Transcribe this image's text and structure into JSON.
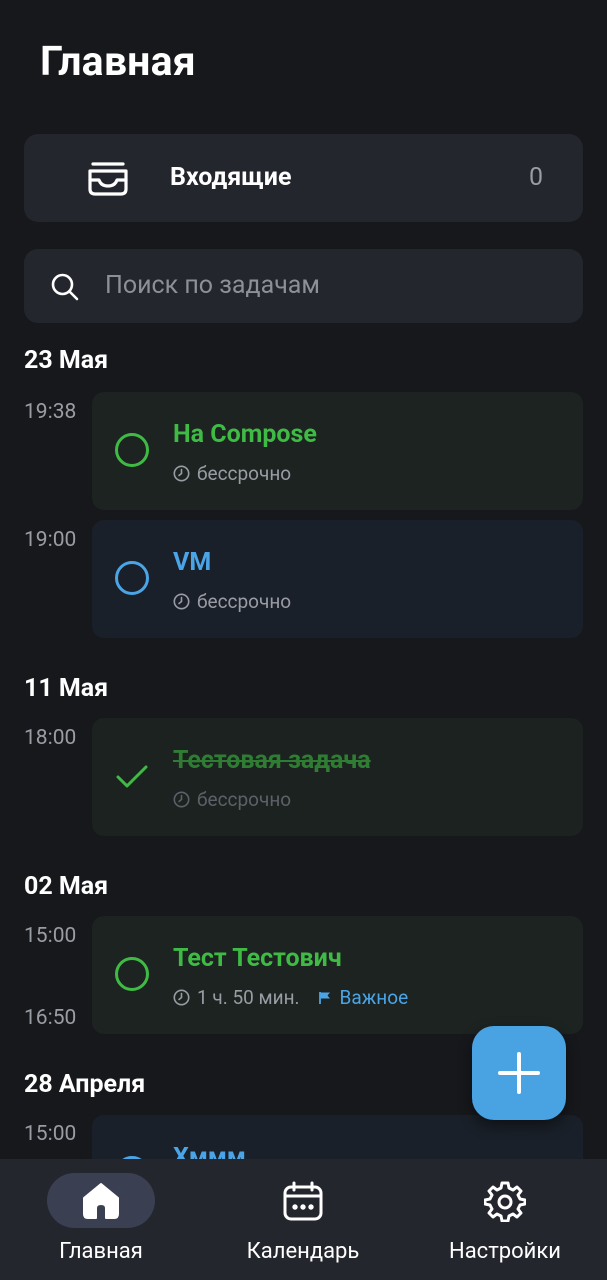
{
  "header": {
    "title": "Главная"
  },
  "inbox": {
    "label": "Входящие",
    "count": "0"
  },
  "search": {
    "placeholder": "Поиск по задачам"
  },
  "groups": [
    {
      "date": "23 Мая",
      "tasks": [
        {
          "time": "19:38",
          "title": "На Compose",
          "duration": "бессрочно",
          "color": "#3fbb45",
          "status": "open"
        },
        {
          "time": "19:00",
          "title": "VM",
          "duration": "бессрочно",
          "color": "#4aa4e6",
          "status": "open"
        }
      ]
    },
    {
      "date": "11 Мая",
      "tasks": [
        {
          "time": "18:00",
          "title": "Тестовая задача",
          "duration": "бессрочно",
          "color": "#3fbb45",
          "status": "done"
        }
      ]
    },
    {
      "date": "02 Мая",
      "tasks": [
        {
          "time": "15:00",
          "end_time": "16:50",
          "title": "Тест Тестович",
          "duration": "1 ч. 50 мин.",
          "priority": "Важное",
          "color": "#3fbb45",
          "status": "open"
        }
      ]
    },
    {
      "date": "28 Апреля",
      "tasks": [
        {
          "time": "15:00",
          "title": "Хммм",
          "color": "#4aa4e6",
          "status": "open"
        }
      ]
    }
  ],
  "fab": {
    "icon": "plus-icon"
  },
  "nav": {
    "items": [
      {
        "label": "Главная",
        "icon": "home-icon",
        "active": true
      },
      {
        "label": "Календарь",
        "icon": "calendar-icon",
        "active": false
      },
      {
        "label": "Настройки",
        "icon": "settings-icon",
        "active": false
      }
    ]
  },
  "colors": {
    "accent_green": "#3fbb45",
    "accent_blue": "#4aa4e6",
    "background": "#17181c",
    "surface": "#24262e"
  }
}
